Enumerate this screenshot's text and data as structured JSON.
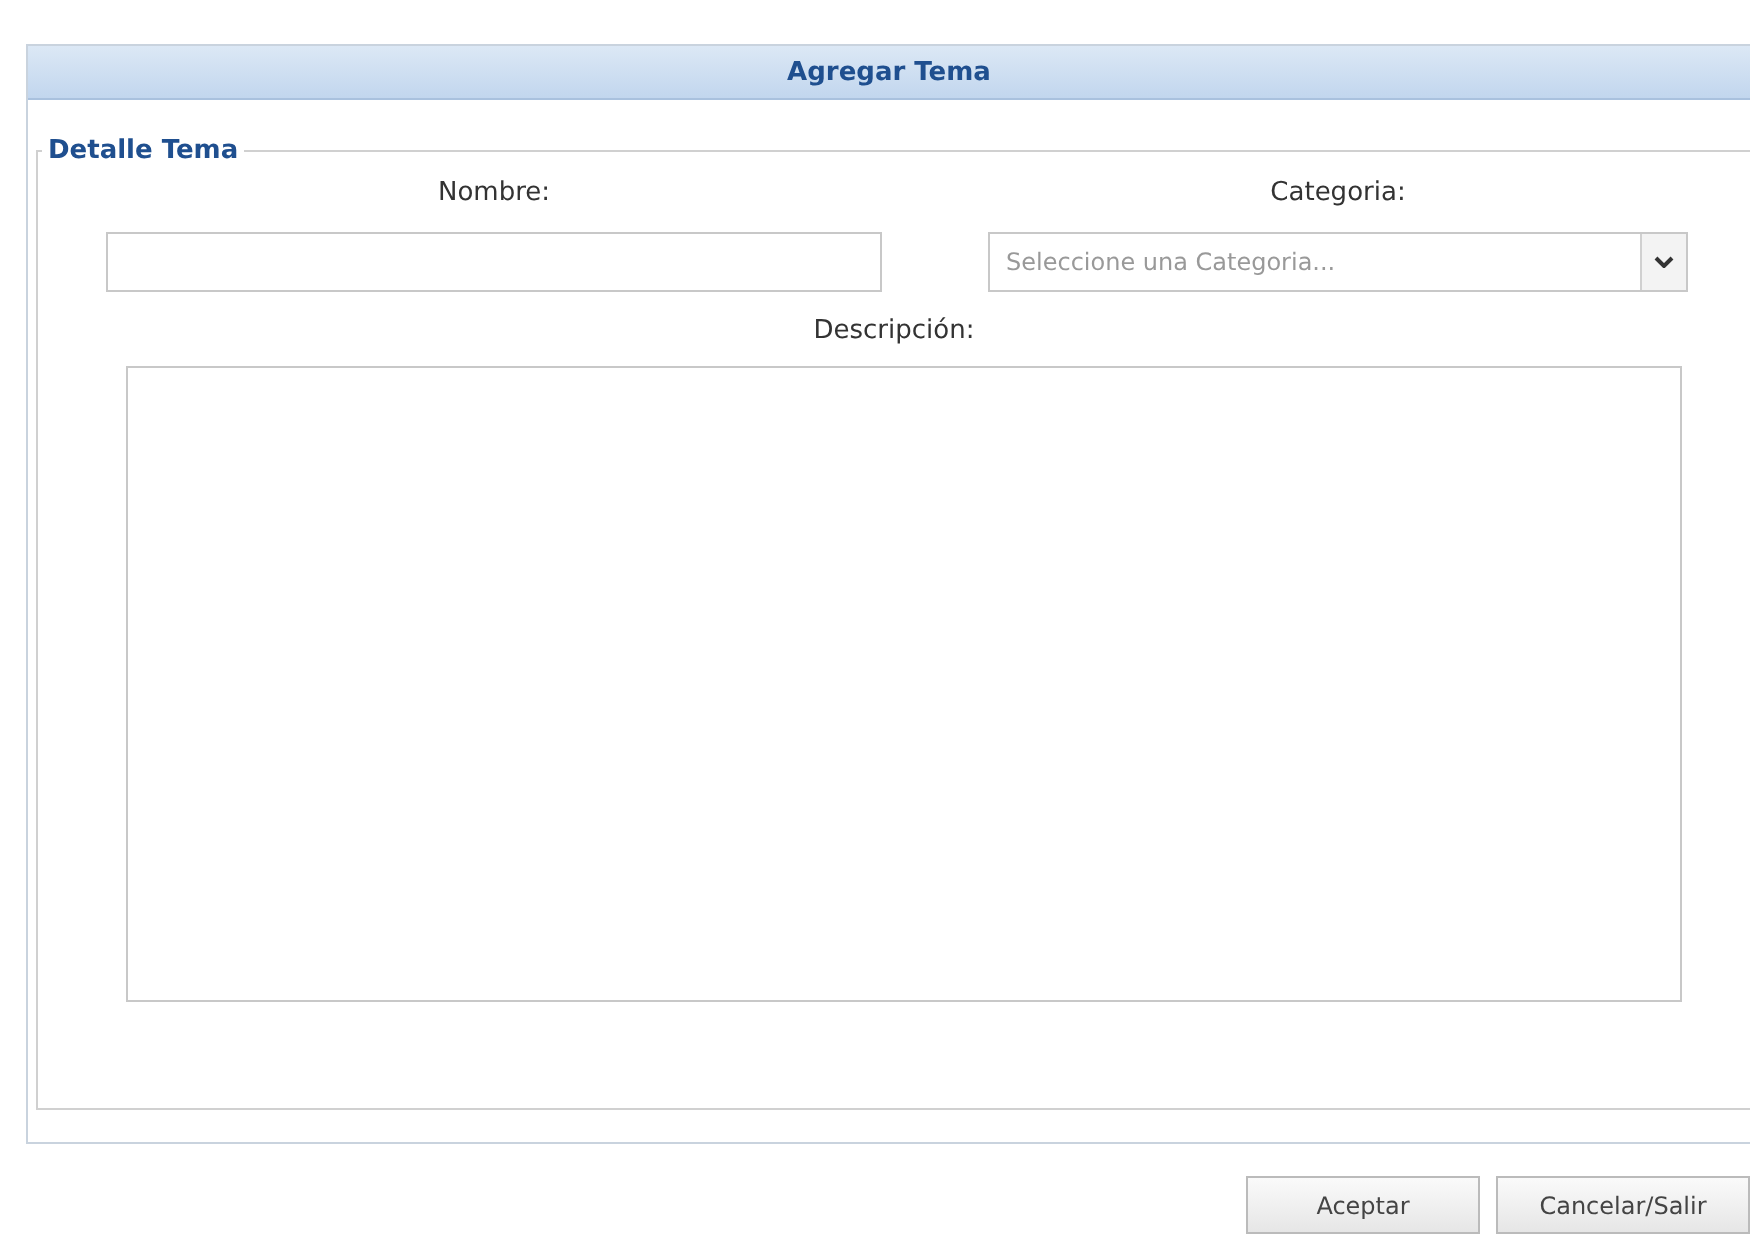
{
  "window": {
    "title": "Agregar Tema"
  },
  "fieldset": {
    "legend": "Detalle Tema"
  },
  "nombre": {
    "label": "Nombre:"
  },
  "categoria": {
    "label": "Categoria:",
    "placeholder": "Seleccione una Categoria..."
  },
  "descripcion": {
    "label": "Descripción:"
  },
  "buttons": [
    {
      "label": "Aceptar"
    },
    {
      "label": "Cancelar/Salir"
    }
  ]
}
